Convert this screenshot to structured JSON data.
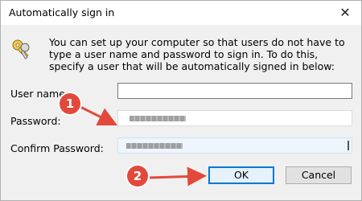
{
  "window": {
    "title": "Automatically sign in",
    "close_glyph": "✕"
  },
  "description": "You can set up your computer so that users do not have to type a user name and password to sign in. To do this, specify a user that will be automatically signed in below:",
  "icon": "keys-icon",
  "fields": {
    "user_name": {
      "label": "User name:",
      "value": ""
    },
    "password": {
      "label": "Password:",
      "value": "masked"
    },
    "confirm_password": {
      "label": "Confirm Password:",
      "value": "masked"
    }
  },
  "buttons": {
    "ok": "OK",
    "cancel": "Cancel"
  },
  "annotations": {
    "step1": "1",
    "step2": "2",
    "color": "#e2493b"
  }
}
